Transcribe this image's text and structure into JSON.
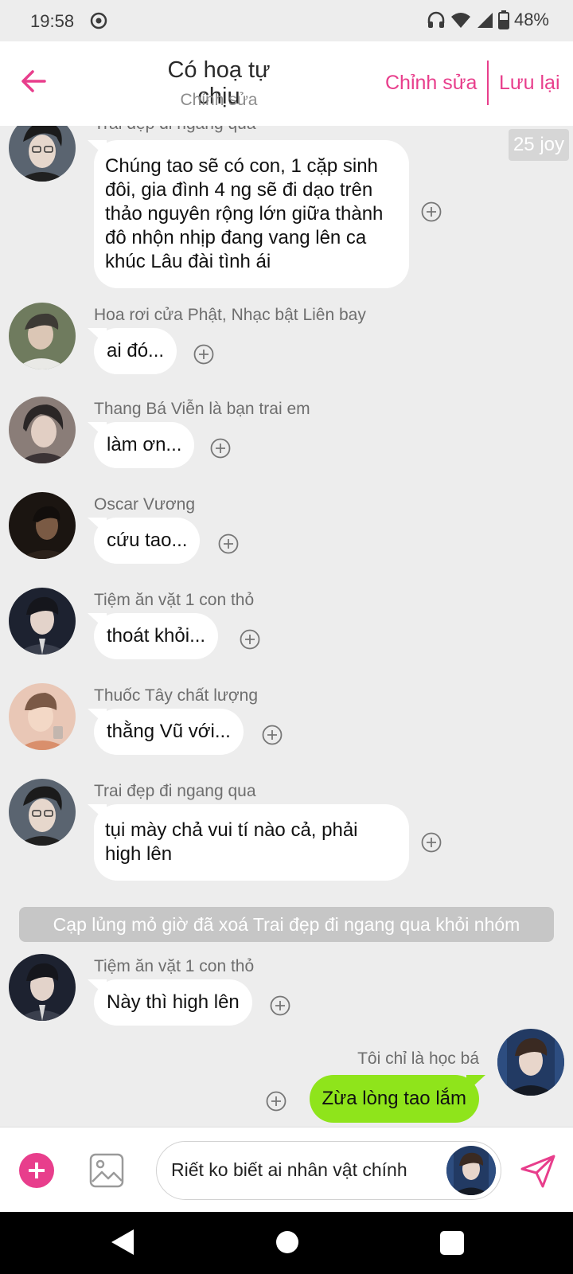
{
  "status_bar": {
    "time": "19:58",
    "battery": "48%",
    "icons": [
      "cast-icon",
      "headphones-icon",
      "wifi-icon",
      "signal-icon",
      "battery-icon"
    ]
  },
  "header": {
    "title": "Có hoạ tự chịu",
    "subtitle": "Chỉnh sửa",
    "edit_label": "Chỉnh sửa",
    "save_label": "Lưu lại",
    "accent_color": "#e83e8c"
  },
  "chat": {
    "joy_badge": "25 joy",
    "messages": [
      {
        "sender": "Trai đẹp đi ngang qua",
        "text": "Chúng tao sẽ có con, 1 cặp sinh đôi, gia đình 4 ng sẽ đi dạo trên thảo nguyên rộng lớn giữa thành đô nhộn nhịp đang vang lên ca khúc Lâu đài tình ái"
      },
      {
        "sender": "Hoa rơi cửa Phật, Nhạc bật Liên bay",
        "text": "ai đó..."
      },
      {
        "sender": "Thang Bá Viễn là bạn trai em",
        "text": "làm ơn..."
      },
      {
        "sender": "Oscar Vương",
        "text": "cứu tao..."
      },
      {
        "sender": "Tiệm ăn vặt 1 con thỏ",
        "text": "thoát khỏi..."
      },
      {
        "sender": "Thuốc Tây chất lượng",
        "text": "thằng Vũ với..."
      },
      {
        "sender": "Trai đẹp đi ngang qua",
        "text": "tụi mày chả vui tí nào cả, phải high lên"
      },
      {
        "sender": "Tiệm ăn vặt 1 con thỏ",
        "text": "Này thì high lên"
      }
    ],
    "system_note": "Cạp lủng mỏ giờ đã xoá Trai đẹp đi ngang qua khỏi nhóm",
    "my_message": {
      "sender": "Tôi chỉ là học bá",
      "text": "Zừa lòng tao lắm",
      "color": "#8fe41b"
    }
  },
  "composer": {
    "input_value": "Riết ko biết ai nhân vật chính"
  }
}
